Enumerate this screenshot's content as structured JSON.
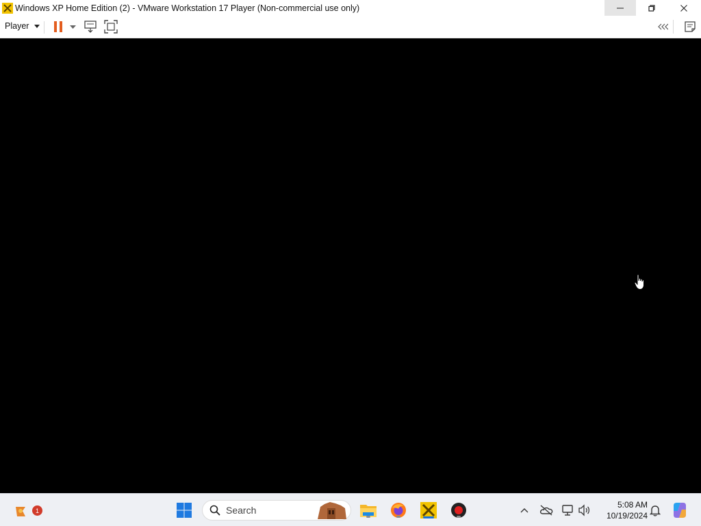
{
  "window": {
    "title": "Windows XP Home Edition (2) - VMware Workstation 17 Player (Non-commercial use only)",
    "controls": {
      "minimize": "minimize-icon",
      "maximize": "restore-icon",
      "close": "close-icon"
    }
  },
  "toolbar": {
    "player_menu_label": "Player",
    "icons": [
      "pause-icon",
      "dropdown-caret-icon",
      "send-ctrl-alt-del-icon",
      "full-screen-icon",
      "collapse-toolbar-icon",
      "message-log-icon"
    ],
    "pause_color": "#e35d1f"
  },
  "vm": {
    "screen_color": "#000000"
  },
  "taskbar": {
    "search_placeholder": "Search",
    "notification_badge": "1",
    "pinned": [
      "windows-start-icon",
      "search-icon",
      "file-explorer-icon",
      "firefox-icon",
      "vmware-player-icon",
      "recorder-icon"
    ],
    "tray": {
      "icons": [
        "show-hidden-icons-chevron",
        "onedrive-offline-icon",
        "network-icon",
        "volume-icon",
        "notification-bell-icon",
        "copilot-icon"
      ],
      "time": "5:08 AM",
      "date": "10/19/2024"
    }
  }
}
